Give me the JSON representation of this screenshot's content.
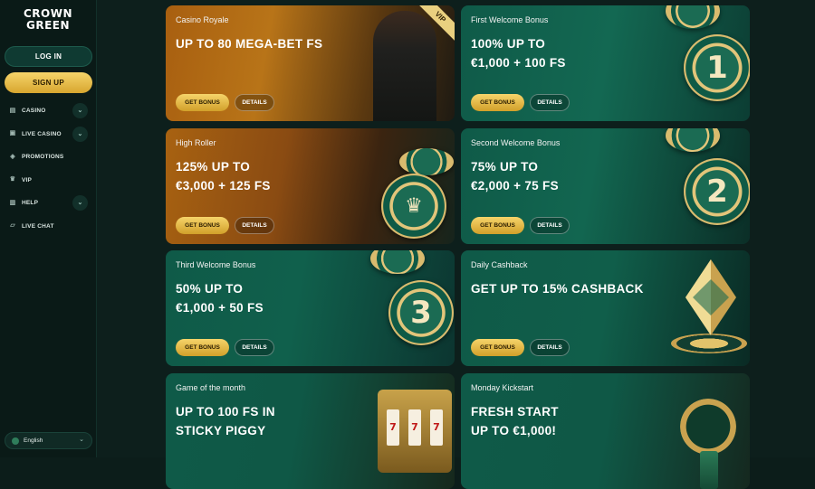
{
  "sidebar": {
    "logo": {
      "line1": "CROWN",
      "line2": "GREEN"
    },
    "login_label": "LOG IN",
    "signup_label": "SIGN UP",
    "items": [
      {
        "label": "CASINO",
        "icon": "casino-icon",
        "expandable": true
      },
      {
        "label": "LIVE CASINO",
        "icon": "live-casino-icon",
        "expandable": true
      },
      {
        "label": "PROMOTIONS",
        "icon": "promotions-icon",
        "expandable": false
      },
      {
        "label": "VIP",
        "icon": "vip-crown-icon",
        "expandable": false
      },
      {
        "label": "HELP",
        "icon": "help-icon",
        "expandable": true
      },
      {
        "label": "LIVE CHAT",
        "icon": "chat-icon",
        "expandable": false
      }
    ],
    "language": "English"
  },
  "promotions": [
    {
      "subtitle": "Casino Royale",
      "headline": "UP TO 80 MEGA-BET FS",
      "badge": "VIP",
      "get_label": "GET BONUS",
      "details_label": "DETAILS"
    },
    {
      "subtitle": "First Welcome Bonus",
      "headline": "100% UP TO\n€1,000 + 100 FS",
      "chip_number": "1",
      "get_label": "GET BONUS",
      "details_label": "DETAILS"
    },
    {
      "subtitle": "High Roller",
      "headline": "125% UP TO\n€3,000 + 125 FS",
      "get_label": "GET BONUS",
      "details_label": "DETAILS"
    },
    {
      "subtitle": "Second Welcome Bonus",
      "headline": "75% UP TO\n€2,000 + 75 FS",
      "chip_number": "2",
      "get_label": "GET BONUS",
      "details_label": "DETAILS"
    },
    {
      "subtitle": "Third Welcome Bonus",
      "headline": "50% UP TO\n€1,000 + 50 FS",
      "chip_number": "3",
      "get_label": "GET BONUS",
      "details_label": "DETAILS"
    },
    {
      "subtitle": "Daily Cashback",
      "headline": "GET UP TO 15% CASHBACK",
      "get_label": "GET BONUS",
      "details_label": "DETAILS"
    },
    {
      "subtitle": "Game of the month",
      "headline": "UP TO 100 FS IN\nSTICKY PIGGY",
      "slot_symbols": "777"
    },
    {
      "subtitle": "Monday Kickstart",
      "headline": "FRESH START\nUP TO €1,000!"
    }
  ],
  "colors": {
    "gold": "#e0b545",
    "green": "#0f5a48",
    "background": "#0c1d1a"
  }
}
